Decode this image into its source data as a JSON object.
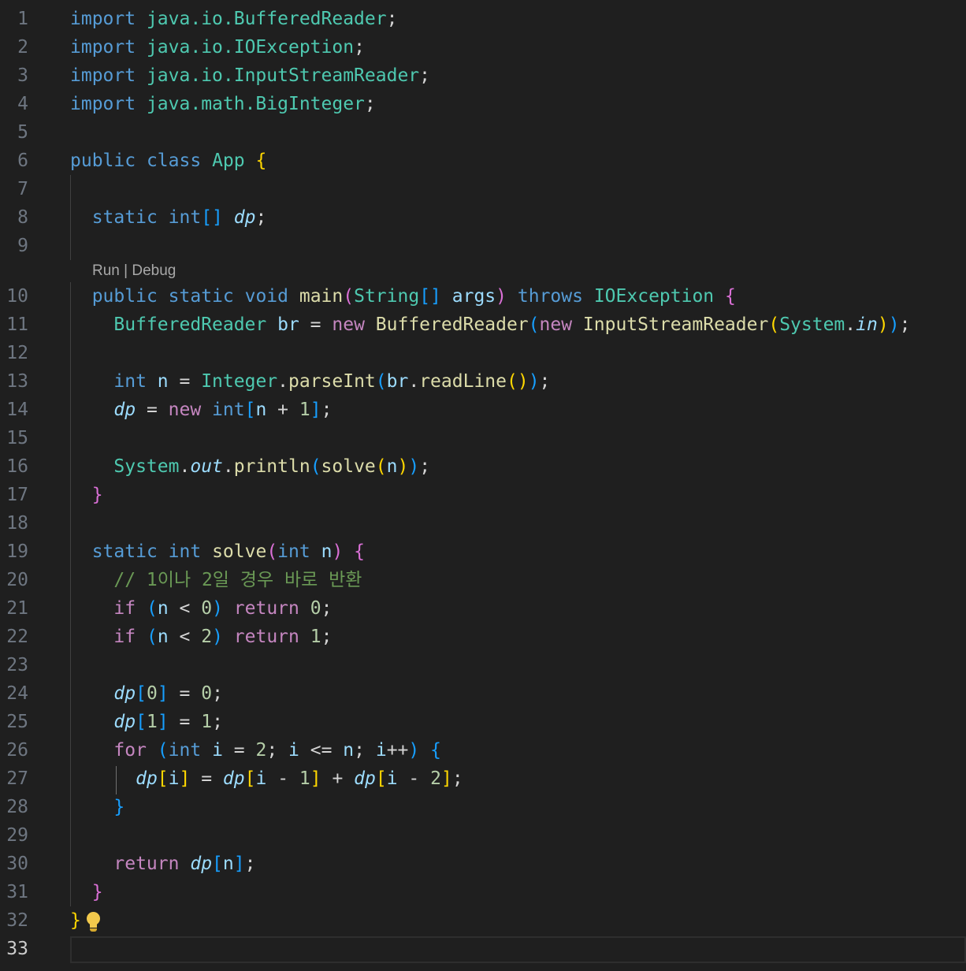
{
  "editor": {
    "language": "java",
    "active_line": 33,
    "codelens": {
      "run_label": "Run",
      "separator": " | ",
      "debug_label": "Debug"
    },
    "lines": [
      {
        "n": 1,
        "tokens": [
          [
            "import",
            "kw"
          ],
          [
            " ",
            "pl"
          ],
          [
            "java.io.BufferedReader",
            "ty"
          ],
          [
            ";",
            "pl"
          ]
        ]
      },
      {
        "n": 2,
        "tokens": [
          [
            "import",
            "kw"
          ],
          [
            " ",
            "pl"
          ],
          [
            "java.io.IOException",
            "ty"
          ],
          [
            ";",
            "pl"
          ]
        ]
      },
      {
        "n": 3,
        "tokens": [
          [
            "import",
            "kw"
          ],
          [
            " ",
            "pl"
          ],
          [
            "java.io.InputStreamReader",
            "ty"
          ],
          [
            ";",
            "pl"
          ]
        ]
      },
      {
        "n": 4,
        "tokens": [
          [
            "import",
            "kw"
          ],
          [
            " ",
            "pl"
          ],
          [
            "java.math.BigInteger",
            "ty"
          ],
          [
            ";",
            "pl"
          ]
        ]
      },
      {
        "n": 5,
        "tokens": []
      },
      {
        "n": 6,
        "tokens": [
          [
            "public",
            "kw"
          ],
          [
            " ",
            "pl"
          ],
          [
            "class",
            "kw"
          ],
          [
            " ",
            "pl"
          ],
          [
            "App",
            "ty"
          ],
          [
            " ",
            "pl"
          ],
          [
            "{",
            "b1"
          ]
        ]
      },
      {
        "n": 7,
        "tokens": []
      },
      {
        "n": 8,
        "tokens": [
          [
            "  ",
            "pl"
          ],
          [
            "static",
            "kw"
          ],
          [
            " ",
            "pl"
          ],
          [
            "int",
            "kw"
          ],
          [
            "[]",
            "b3"
          ],
          [
            " ",
            "pl"
          ],
          [
            "dp",
            "it"
          ],
          [
            ";",
            "pl"
          ]
        ]
      },
      {
        "n": 9,
        "tokens": []
      },
      {
        "n": 10,
        "tokens": [
          [
            "  ",
            "pl"
          ],
          [
            "public",
            "kw"
          ],
          [
            " ",
            "pl"
          ],
          [
            "static",
            "kw"
          ],
          [
            " ",
            "pl"
          ],
          [
            "void",
            "kw"
          ],
          [
            " ",
            "pl"
          ],
          [
            "main",
            "fn"
          ],
          [
            "(",
            "b2"
          ],
          [
            "String",
            "ty"
          ],
          [
            "[]",
            "b3"
          ],
          [
            " ",
            "pl"
          ],
          [
            "args",
            "var"
          ],
          [
            ")",
            "b2"
          ],
          [
            " ",
            "pl"
          ],
          [
            "throws",
            "kw"
          ],
          [
            " ",
            "pl"
          ],
          [
            "IOException",
            "ty"
          ],
          [
            " ",
            "pl"
          ],
          [
            "{",
            "b2"
          ]
        ]
      },
      {
        "n": 11,
        "tokens": [
          [
            "    ",
            "pl"
          ],
          [
            "BufferedReader",
            "ty"
          ],
          [
            " ",
            "pl"
          ],
          [
            "br",
            "var"
          ],
          [
            " = ",
            "op"
          ],
          [
            "new",
            "ctl"
          ],
          [
            " ",
            "pl"
          ],
          [
            "BufferedReader",
            "fn"
          ],
          [
            "(",
            "b3"
          ],
          [
            "new",
            "ctl"
          ],
          [
            " ",
            "pl"
          ],
          [
            "InputStreamReader",
            "fn"
          ],
          [
            "(",
            "b1"
          ],
          [
            "System",
            "ty"
          ],
          [
            ".",
            "pl"
          ],
          [
            "in",
            "it"
          ],
          [
            ")",
            "b1"
          ],
          [
            ")",
            "b3"
          ],
          [
            ";",
            "pl"
          ]
        ]
      },
      {
        "n": 12,
        "tokens": []
      },
      {
        "n": 13,
        "tokens": [
          [
            "    ",
            "pl"
          ],
          [
            "int",
            "kw"
          ],
          [
            " ",
            "pl"
          ],
          [
            "n",
            "var"
          ],
          [
            " = ",
            "op"
          ],
          [
            "Integer",
            "ty"
          ],
          [
            ".",
            "pl"
          ],
          [
            "parseInt",
            "fn"
          ],
          [
            "(",
            "b3"
          ],
          [
            "br",
            "var"
          ],
          [
            ".",
            "pl"
          ],
          [
            "readLine",
            "fn"
          ],
          [
            "()",
            "b1"
          ],
          [
            ")",
            "b3"
          ],
          [
            ";",
            "pl"
          ]
        ]
      },
      {
        "n": 14,
        "tokens": [
          [
            "    ",
            "pl"
          ],
          [
            "dp",
            "it"
          ],
          [
            " = ",
            "op"
          ],
          [
            "new",
            "ctl"
          ],
          [
            " ",
            "pl"
          ],
          [
            "int",
            "kw"
          ],
          [
            "[",
            "b3"
          ],
          [
            "n",
            "var"
          ],
          [
            " + ",
            "op"
          ],
          [
            "1",
            "num"
          ],
          [
            "]",
            "b3"
          ],
          [
            ";",
            "pl"
          ]
        ]
      },
      {
        "n": 15,
        "tokens": []
      },
      {
        "n": 16,
        "tokens": [
          [
            "    ",
            "pl"
          ],
          [
            "System",
            "ty"
          ],
          [
            ".",
            "pl"
          ],
          [
            "out",
            "it"
          ],
          [
            ".",
            "pl"
          ],
          [
            "println",
            "fn"
          ],
          [
            "(",
            "b3"
          ],
          [
            "solve",
            "fn"
          ],
          [
            "(",
            "b1"
          ],
          [
            "n",
            "var"
          ],
          [
            ")",
            "b1"
          ],
          [
            ")",
            "b3"
          ],
          [
            ";",
            "pl"
          ]
        ]
      },
      {
        "n": 17,
        "tokens": [
          [
            "  ",
            "pl"
          ],
          [
            "}",
            "b2"
          ]
        ]
      },
      {
        "n": 18,
        "tokens": []
      },
      {
        "n": 19,
        "tokens": [
          [
            "  ",
            "pl"
          ],
          [
            "static",
            "kw"
          ],
          [
            " ",
            "pl"
          ],
          [
            "int",
            "kw"
          ],
          [
            " ",
            "pl"
          ],
          [
            "solve",
            "fn"
          ],
          [
            "(",
            "b2"
          ],
          [
            "int",
            "kw"
          ],
          [
            " ",
            "pl"
          ],
          [
            "n",
            "var"
          ],
          [
            ")",
            "b2"
          ],
          [
            " ",
            "pl"
          ],
          [
            "{",
            "b2"
          ]
        ]
      },
      {
        "n": 20,
        "tokens": [
          [
            "    ",
            "pl"
          ],
          [
            "// 1이나 2일 경우 바로 반환",
            "cm"
          ]
        ]
      },
      {
        "n": 21,
        "tokens": [
          [
            "    ",
            "pl"
          ],
          [
            "if",
            "ctl"
          ],
          [
            " ",
            "pl"
          ],
          [
            "(",
            "b3"
          ],
          [
            "n",
            "var"
          ],
          [
            " < ",
            "op"
          ],
          [
            "0",
            "num"
          ],
          [
            ")",
            "b3"
          ],
          [
            " ",
            "pl"
          ],
          [
            "return",
            "ctl"
          ],
          [
            " ",
            "pl"
          ],
          [
            "0",
            "num"
          ],
          [
            ";",
            "pl"
          ]
        ]
      },
      {
        "n": 22,
        "tokens": [
          [
            "    ",
            "pl"
          ],
          [
            "if",
            "ctl"
          ],
          [
            " ",
            "pl"
          ],
          [
            "(",
            "b3"
          ],
          [
            "n",
            "var"
          ],
          [
            " < ",
            "op"
          ],
          [
            "2",
            "num"
          ],
          [
            ")",
            "b3"
          ],
          [
            " ",
            "pl"
          ],
          [
            "return",
            "ctl"
          ],
          [
            " ",
            "pl"
          ],
          [
            "1",
            "num"
          ],
          [
            ";",
            "pl"
          ]
        ]
      },
      {
        "n": 23,
        "tokens": []
      },
      {
        "n": 24,
        "tokens": [
          [
            "    ",
            "pl"
          ],
          [
            "dp",
            "it"
          ],
          [
            "[",
            "b3"
          ],
          [
            "0",
            "num"
          ],
          [
            "]",
            "b3"
          ],
          [
            " = ",
            "op"
          ],
          [
            "0",
            "num"
          ],
          [
            ";",
            "pl"
          ]
        ]
      },
      {
        "n": 25,
        "tokens": [
          [
            "    ",
            "pl"
          ],
          [
            "dp",
            "it"
          ],
          [
            "[",
            "b3"
          ],
          [
            "1",
            "num"
          ],
          [
            "]",
            "b3"
          ],
          [
            " = ",
            "op"
          ],
          [
            "1",
            "num"
          ],
          [
            ";",
            "pl"
          ]
        ]
      },
      {
        "n": 26,
        "tokens": [
          [
            "    ",
            "pl"
          ],
          [
            "for",
            "ctl"
          ],
          [
            " ",
            "pl"
          ],
          [
            "(",
            "b3"
          ],
          [
            "int",
            "kw"
          ],
          [
            " ",
            "pl"
          ],
          [
            "i",
            "var"
          ],
          [
            " = ",
            "op"
          ],
          [
            "2",
            "num"
          ],
          [
            "; ",
            "pl"
          ],
          [
            "i",
            "var"
          ],
          [
            " <= ",
            "op"
          ],
          [
            "n",
            "var"
          ],
          [
            "; ",
            "pl"
          ],
          [
            "i",
            "var"
          ],
          [
            "++",
            "op"
          ],
          [
            ")",
            "b3"
          ],
          [
            " ",
            "pl"
          ],
          [
            "{",
            "b3"
          ]
        ]
      },
      {
        "n": 27,
        "tokens": [
          [
            "      ",
            "pl"
          ],
          [
            "dp",
            "it"
          ],
          [
            "[",
            "b1"
          ],
          [
            "i",
            "var"
          ],
          [
            "]",
            "b1"
          ],
          [
            " = ",
            "op"
          ],
          [
            "dp",
            "it"
          ],
          [
            "[",
            "b1"
          ],
          [
            "i",
            "var"
          ],
          [
            " - ",
            "op"
          ],
          [
            "1",
            "num"
          ],
          [
            "]",
            "b1"
          ],
          [
            " + ",
            "op"
          ],
          [
            "dp",
            "it"
          ],
          [
            "[",
            "b1"
          ],
          [
            "i",
            "var"
          ],
          [
            " - ",
            "op"
          ],
          [
            "2",
            "num"
          ],
          [
            "]",
            "b1"
          ],
          [
            ";",
            "pl"
          ]
        ]
      },
      {
        "n": 28,
        "tokens": [
          [
            "    ",
            "pl"
          ],
          [
            "}",
            "b3"
          ]
        ]
      },
      {
        "n": 29,
        "tokens": []
      },
      {
        "n": 30,
        "tokens": [
          [
            "    ",
            "pl"
          ],
          [
            "return",
            "ctl"
          ],
          [
            " ",
            "pl"
          ],
          [
            "dp",
            "it"
          ],
          [
            "[",
            "b3"
          ],
          [
            "n",
            "var"
          ],
          [
            "]",
            "b3"
          ],
          [
            ";",
            "pl"
          ]
        ]
      },
      {
        "n": 31,
        "tokens": [
          [
            "  ",
            "pl"
          ],
          [
            "}",
            "b2"
          ]
        ]
      },
      {
        "n": 32,
        "tokens": [
          [
            "}",
            "b1"
          ]
        ],
        "lightbulb": "lightbulb-icon"
      },
      {
        "n": 33,
        "tokens": []
      }
    ]
  }
}
